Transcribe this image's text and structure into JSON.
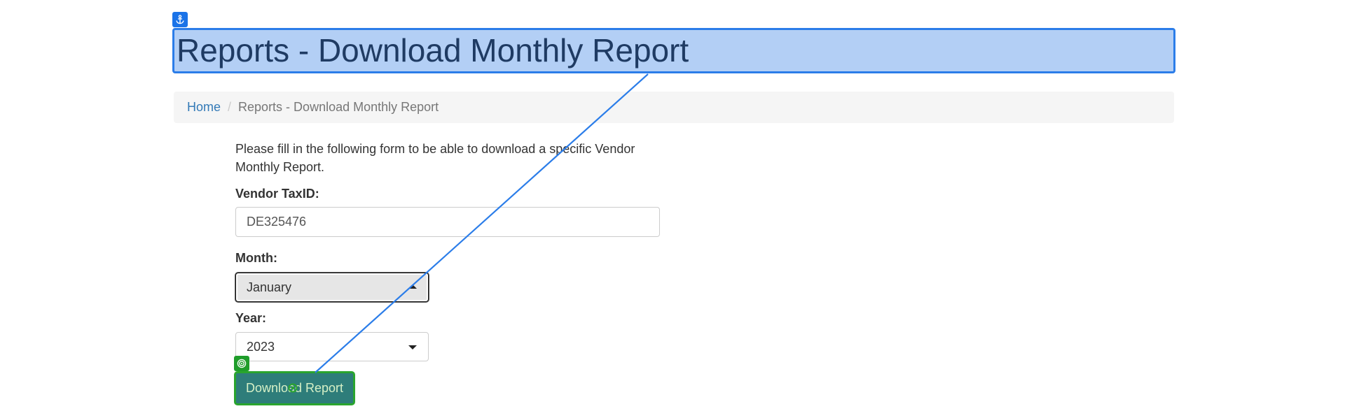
{
  "title": {
    "text": "Reports - Download Monthly Report",
    "anchor_icon": "anchor-icon",
    "highlight_color": "#b3cff5",
    "highlight_border": "#2b7de9"
  },
  "breadcrumb": {
    "home_label": "Home",
    "separator": "/",
    "current_label": "Reports - Download Monthly Report"
  },
  "form": {
    "intro_text": "Please fill in the following form to be able to download a specific Vendor Monthly Report.",
    "vendor_taxid": {
      "label": "Vendor TaxID:",
      "value": "DE325476"
    },
    "month": {
      "label": "Month:",
      "selected": "January"
    },
    "year": {
      "label": "Year:",
      "selected": "2023"
    },
    "download_button": {
      "label": "Download Report",
      "target_icon": "target-icon",
      "background": "#2e7d7a",
      "highlight_border": "#2aa52e"
    }
  }
}
